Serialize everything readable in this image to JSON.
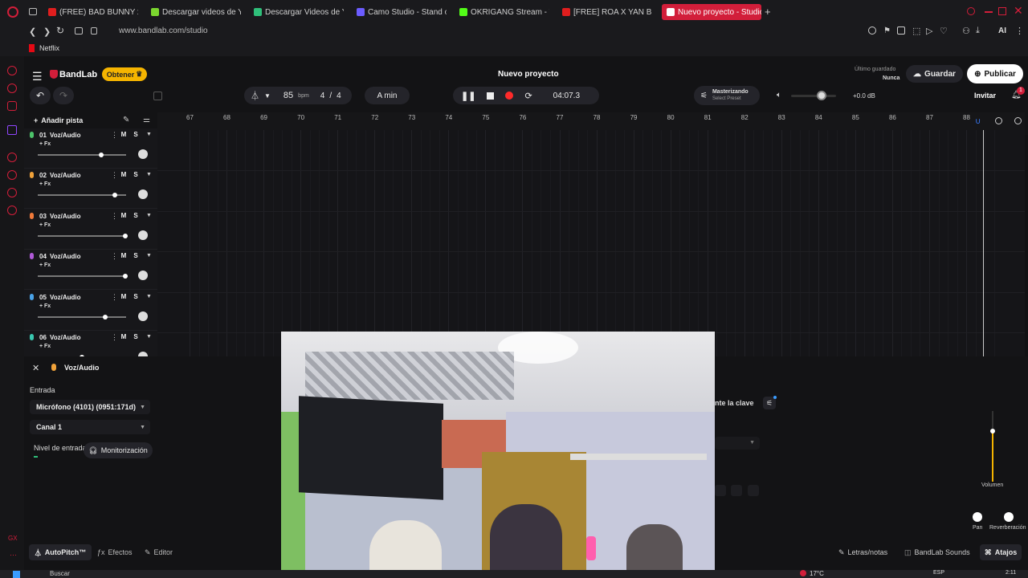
{
  "browser": {
    "tabs": [
      {
        "label": "(FREE) BAD BUNNY x TAI",
        "color": "#e01e1e"
      },
      {
        "label": "Descargar videos de YouT",
        "color": "#7bd62f"
      },
      {
        "label": "Descargar Videos de YouT",
        "color": "#2fbf7a"
      },
      {
        "label": "Camo Studio - Stand out w",
        "color": "#6b5cff"
      },
      {
        "label": "OKRIGANG Stream - Watc",
        "color": "#53fc18"
      },
      {
        "label": "[FREE] ROA X YAN BLOCK",
        "color": "#e01e1e"
      },
      {
        "label": "Nuevo proyecto - Studio",
        "color": "#ffffff"
      }
    ],
    "new_tab": "+",
    "url": "www.bandlab.com/studio",
    "bookmark": "Netflix",
    "ai_label": "AI"
  },
  "header": {
    "logo": "BandLab",
    "obtener": "Obtener",
    "project_title": "Nuevo proyecto",
    "last_saved_label": "Último guardado",
    "last_saved_value": "Nunca",
    "save": "Guardar",
    "publish": "Publicar"
  },
  "transport": {
    "bpm": "85",
    "bpm_unit": "bpm",
    "time_sig_num": "4",
    "time_sig_sep": "/",
    "time_sig_den": "4",
    "key": "A min",
    "time": "04:07.3",
    "mastering_title": "Masterizando",
    "mastering_preset": "Select Preset",
    "volume_db": "+0.0 dB",
    "invite": "Invitar",
    "notif_count": "1"
  },
  "ruler": {
    "bars": [
      "67",
      "68",
      "69",
      "70",
      "71",
      "72",
      "73",
      "74",
      "75",
      "76",
      "77",
      "78",
      "79",
      "80",
      "81",
      "82",
      "83",
      "84",
      "85",
      "86",
      "87",
      "88"
    ]
  },
  "tracks_panel": {
    "add_track": "Añadir pista",
    "mute": "M",
    "solo": "S",
    "fx": "+ Fx",
    "tracks": [
      {
        "num": "01",
        "name": "Voz/Audio",
        "color": "#4cc36a",
        "vol": 0.72
      },
      {
        "num": "02",
        "name": "Voz/Audio",
        "color": "#f0a23a",
        "vol": 0.87
      },
      {
        "num": "03",
        "name": "Voz/Audio",
        "color": "#f07a3a",
        "vol": 0.99
      },
      {
        "num": "04",
        "name": "Voz/Audio",
        "color": "#b05ad8",
        "vol": 0.99
      },
      {
        "num": "05",
        "name": "Voz/Audio",
        "color": "#4aa3e8",
        "vol": 0.76
      },
      {
        "num": "06",
        "name": "Voz/Audio",
        "color": "#3ac8b0",
        "vol": 0.5
      }
    ]
  },
  "bottom_panel": {
    "track_type": "Voz/Audio",
    "input_label": "Entrada",
    "mic": "Micrófono (4101) (0951:171d)",
    "channel": "Canal 1",
    "input_level": "Nivel de entrada",
    "monitor": "Monitorización",
    "key_label": "nte la clave",
    "volume_label": "Volumen",
    "pan_label": "Pan",
    "reverb_label": "Reverberación",
    "autopitch": "AutoPitch™",
    "effects": "Efectos",
    "editor": "Editor",
    "lyrics": "Letras/notas",
    "sounds": "BandLab Sounds",
    "shortcuts": "Atajos"
  },
  "taskbar": {
    "search": "Buscar",
    "weather": "17°C",
    "lang": "ESP",
    "clock": "2:11"
  },
  "colors": {
    "accent": "#d21e3a",
    "record": "#ff2a2a",
    "obtener": "#f5b400"
  }
}
